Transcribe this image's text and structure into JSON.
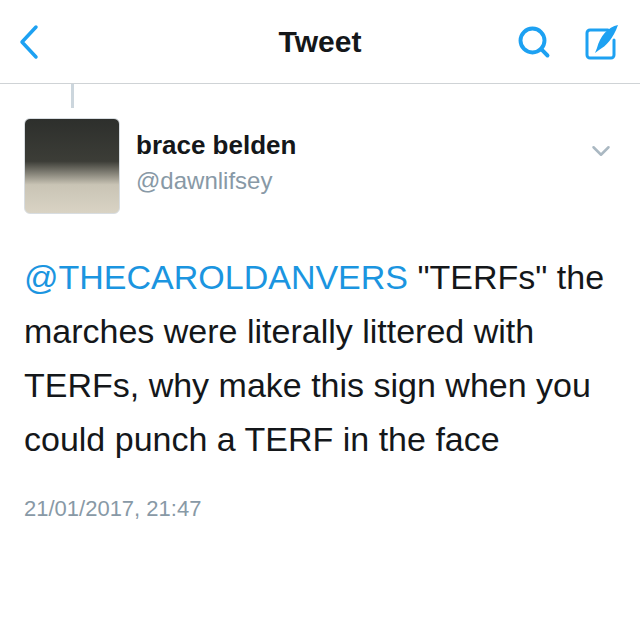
{
  "nav": {
    "title": "Tweet"
  },
  "tweet": {
    "author": {
      "name": "brace belden",
      "handle": "@dawnlifsey"
    },
    "mention": "@THECAROLDANVERS",
    "text": " \"TERFs\" the marches were literally littered with TERFs, why make this sign when you could punch a TERF in the face",
    "timestamp": "21/01/2017, 21:47"
  }
}
